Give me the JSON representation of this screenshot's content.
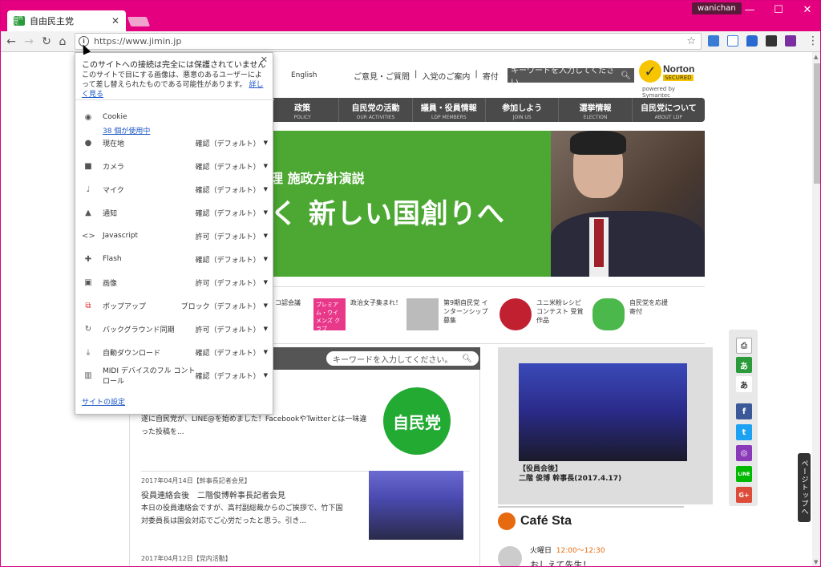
{
  "browser": {
    "tab_title": "自由民主党",
    "favicon_text": "自民党",
    "user_badge": "wanichan",
    "url": "https://www.jimin.jp",
    "window_controls": {
      "minimize": "—",
      "maximize": "☐",
      "close": "✕"
    }
  },
  "site": {
    "english_link": "English",
    "top_links": [
      "ご意見・ご質問",
      "入党のご案内",
      "寄付"
    ],
    "search_placeholder": "キーワードを入力してください",
    "norton": {
      "name": "Norton",
      "secured": "SECURED",
      "powered": "powered by Symantec"
    },
    "nav": [
      {
        "jp": "政策",
        "en": "POLICY"
      },
      {
        "jp": "自民党の活動",
        "en": "OUR ACTIVITIES"
      },
      {
        "jp": "議員・役員情報",
        "en": "LDP MEMBERS"
      },
      {
        "jp": "参加しよう",
        "en": "JOIN US"
      },
      {
        "jp": "選挙情報",
        "en": "ELECTION"
      },
      {
        "jp": "自民党について",
        "en": "ABOUT LDP"
      }
    ],
    "hero": {
      "subtitle": "理 施政方針演説",
      "title": "く 新しい国創りへ"
    },
    "banners": [
      {
        "label": "コ認会議"
      },
      {
        "thumb": "プレミアム・ウイメンズ クラブ",
        "label": "政治女子集まれ！"
      },
      {
        "label": "第9期自民党 インターンシップ募集"
      },
      {
        "label": "ユニ米粉レシピコンテスト 受賞作品"
      },
      {
        "label": "自民党を応援 寄付"
      }
    ],
    "keyword_placeholder": "キーワードを入力してください。",
    "news": [
      {
        "body": "遂に自民党が、LINE@を始めました！FacebookやTwitterとは一味違った投稿を..."
      },
      {
        "date": "2017年04月14日【幹事長記者会見】",
        "title": "役員連絡会後　二階俊博幹事長記者会見",
        "body": "本日の役員連絡会ですが、高村副総裁からのご挨拶で、竹下国対委員長は国会対応でご心労だったと思う。引き..."
      },
      {
        "date": "2017年04月12日【党内活動】"
      }
    ],
    "ldp_logo": "自民党",
    "video_caption": [
      "【役員会後】",
      "二階 俊博 幹事長(2017.4.17)"
    ],
    "cafe": {
      "name": "Café Sta",
      "day": "火曜日",
      "time": "12:00〜12:30",
      "show": "おしえて先生！"
    },
    "page_top": "ページトップへ",
    "social": [
      "あ",
      "あ",
      "f",
      "t",
      "◎",
      "LINE",
      "G+"
    ]
  },
  "popup": {
    "title": "このサイトへの接続は完全には保護されていません",
    "desc": "このサイトで目にする画像は、悪意のあるユーザーによって差し替えられたものである可能性があります。",
    "learn_more": "詳しく見る",
    "cookie_label": "Cookie",
    "cookie_count": "38 個が使用中",
    "permissions": [
      {
        "icon": "location-icon",
        "label": "現在地",
        "value": "確認（デフォルト）"
      },
      {
        "icon": "camera-icon",
        "label": "カメラ",
        "value": "確認（デフォルト）"
      },
      {
        "icon": "mic-icon",
        "label": "マイク",
        "value": "確認（デフォルト）"
      },
      {
        "icon": "bell-icon",
        "label": "通知",
        "value": "確認（デフォルト）"
      },
      {
        "icon": "code-icon",
        "label": "Javascript",
        "value": "許可（デフォルト）"
      },
      {
        "icon": "puzzle-icon",
        "label": "Flash",
        "value": "確認（デフォルト）"
      },
      {
        "icon": "image-icon",
        "label": "画像",
        "value": "許可（デフォルト）"
      },
      {
        "icon": "popup-icon",
        "label": "ポップアップ",
        "value": "ブロック（デフォルト）"
      },
      {
        "icon": "sync-icon",
        "label": "バックグラウンド同期",
        "value": "許可（デフォルト）"
      },
      {
        "icon": "download-icon",
        "label": "自動ダウンロード",
        "value": "確認（デフォルト）"
      },
      {
        "icon": "midi-icon",
        "label": "MIDI デバイスのフル コントロール",
        "value": "確認（デフォルト）"
      }
    ],
    "site_settings": "サイトの設定"
  }
}
